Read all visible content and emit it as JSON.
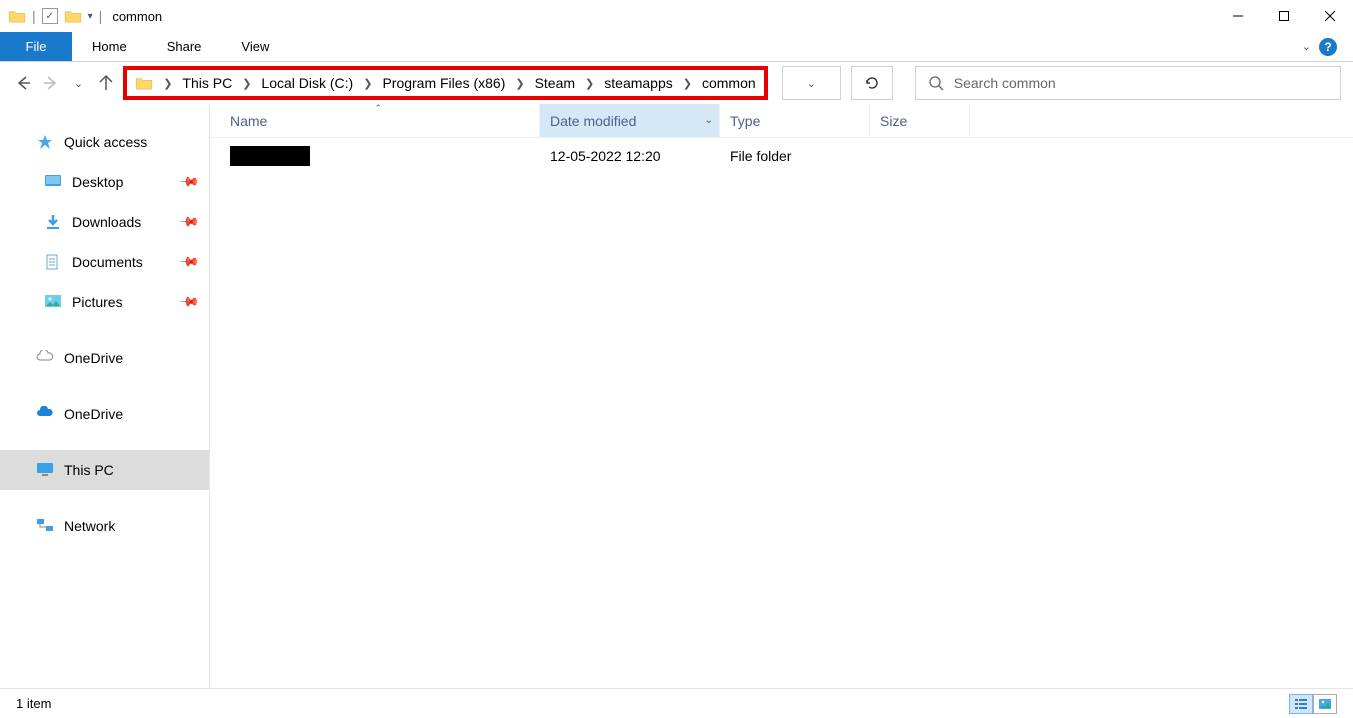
{
  "window": {
    "title": "common"
  },
  "ribbon": {
    "file": "File",
    "tabs": [
      "Home",
      "Share",
      "View"
    ]
  },
  "breadcrumb": [
    "This PC",
    "Local Disk (C:)",
    "Program Files (x86)",
    "Steam",
    "steamapps",
    "common"
  ],
  "search": {
    "placeholder": "Search common"
  },
  "sidebar": {
    "quick_access": "Quick access",
    "items": [
      {
        "label": "Desktop",
        "pinned": true
      },
      {
        "label": "Downloads",
        "pinned": true
      },
      {
        "label": "Documents",
        "pinned": true
      },
      {
        "label": "Pictures",
        "pinned": true
      }
    ],
    "onedrive1": "OneDrive",
    "onedrive2": "OneDrive",
    "this_pc": "This PC",
    "network": "Network"
  },
  "columns": {
    "name": "Name",
    "date_modified": "Date modified",
    "type": "Type",
    "size": "Size"
  },
  "rows": [
    {
      "name": "",
      "date_modified": "12-05-2022 12:20",
      "type": "File folder",
      "size": ""
    }
  ],
  "status": {
    "count": "1 item"
  }
}
